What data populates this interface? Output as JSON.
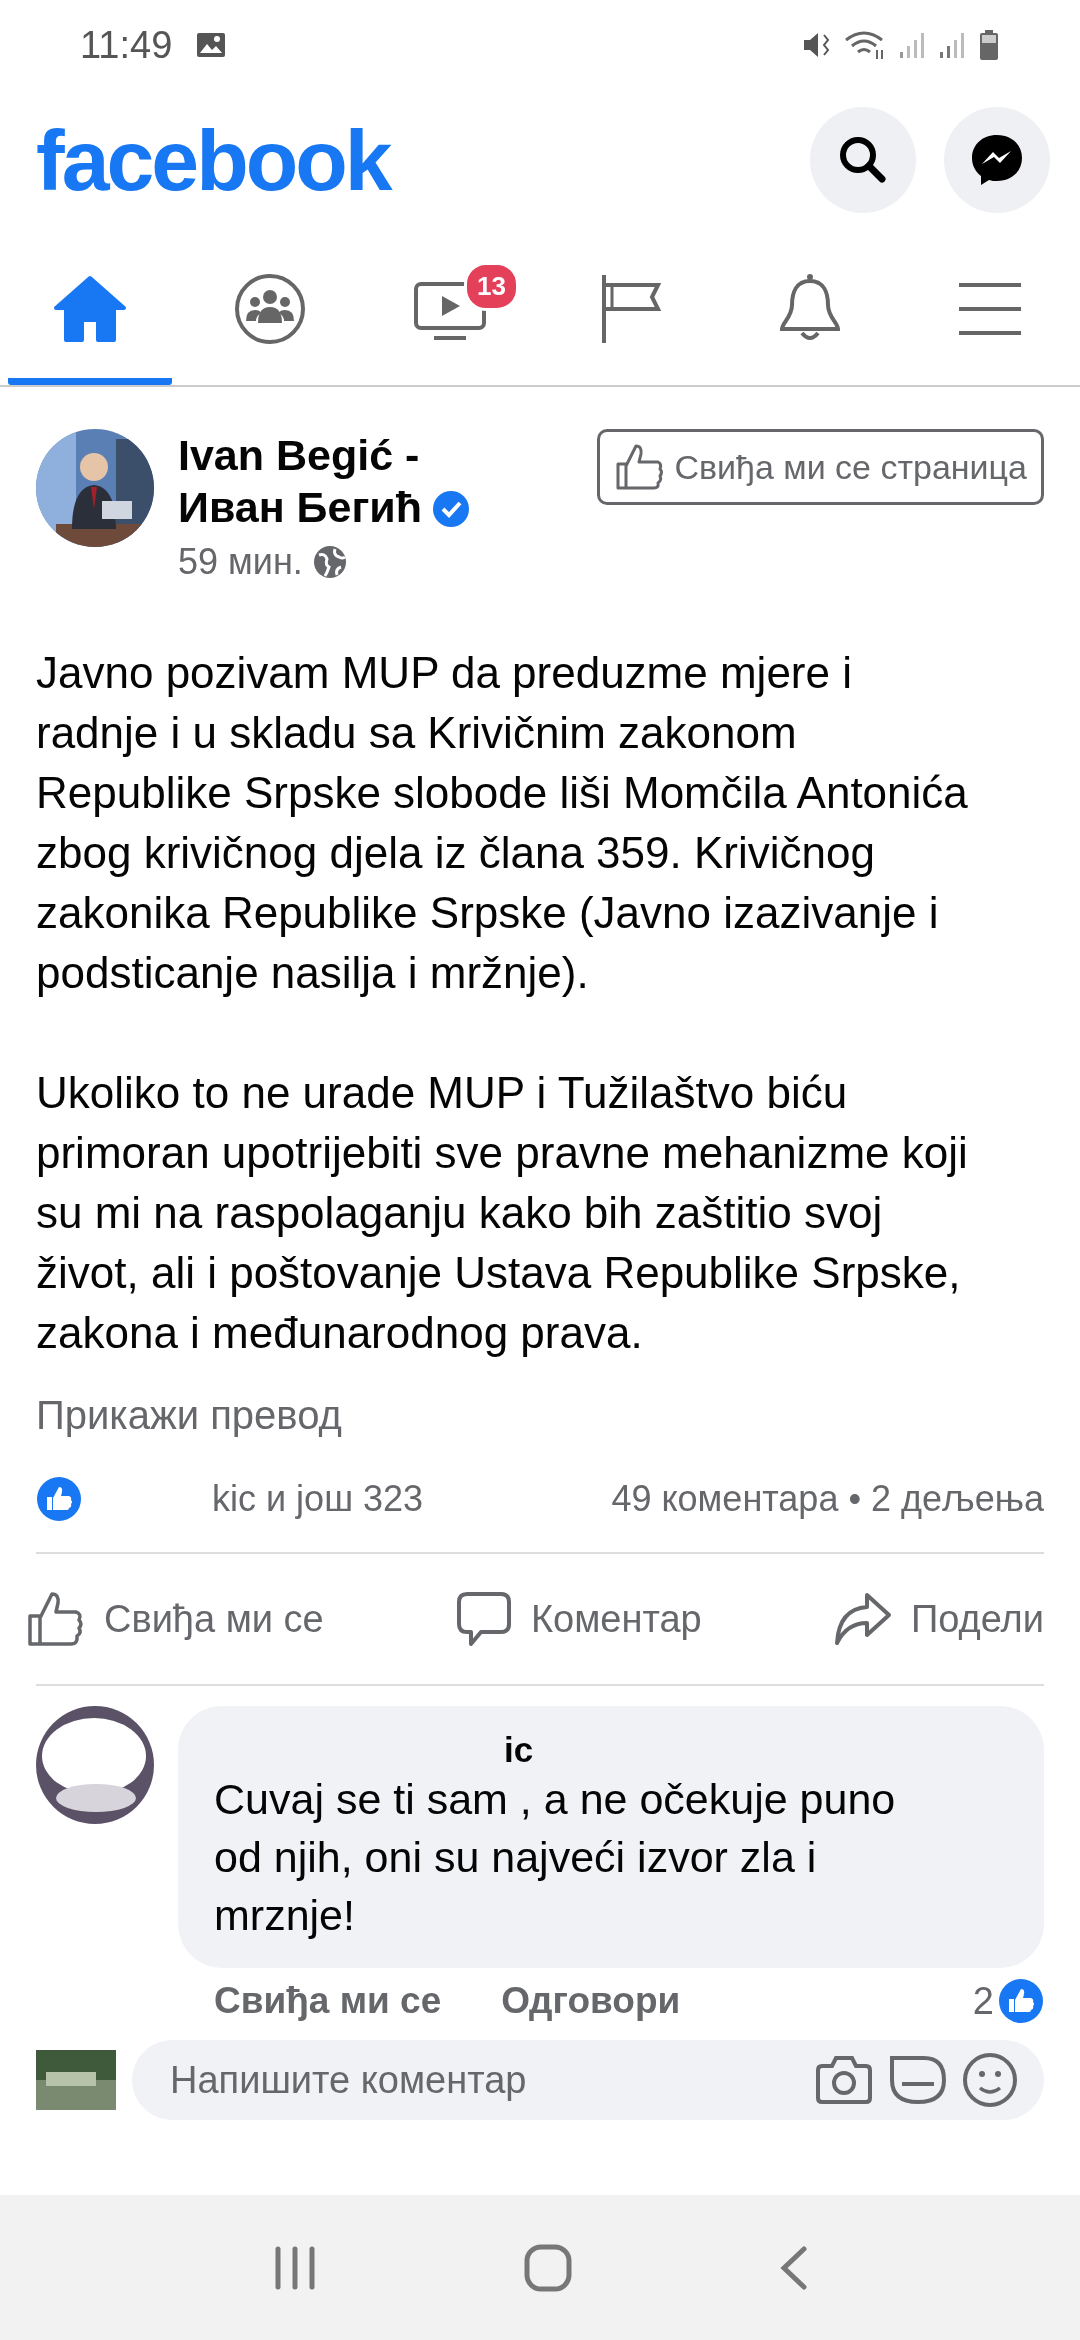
{
  "status_bar": {
    "time": "11:49"
  },
  "header": {
    "logo": "facebook"
  },
  "tabs": [
    {
      "kind": "home",
      "selected": true
    },
    {
      "kind": "groups",
      "selected": false
    },
    {
      "kind": "watch",
      "selected": false,
      "badge": "13"
    },
    {
      "kind": "pages",
      "selected": false
    },
    {
      "kind": "notifications",
      "selected": false
    },
    {
      "kind": "menu",
      "selected": false
    }
  ],
  "post": {
    "author": "Ivan Begić - Иван Бегић",
    "verified": true,
    "time": "59 мин.",
    "like_page": "Свиђа ми се страница",
    "paragraphs": [
      "Javno pozivam MUP da preduzme mjere i radnje i u skladu sa Krivičnim zakonom Republike Srpske slobode liši Momčila Antonića zbog krivičnog djela iz člana 359. Krivičnog zakonika Republike Srpske (Javno izazivanje i podsticanje nasilja i mržnje).",
      "Ukoliko to ne urade MUP i Tužilaštvo biću primoran upotrijebiti sve pravne mehanizme koji su mi na raspolaganju kako bih zaštitio svoj život, ali i poštovanje Ustava Republike Srpske, zakona i međunarodnog prava."
    ],
    "translate": "Прикажи превод",
    "reactions": "kic и још 323",
    "comments_count": "49 коментара • 2 дељења",
    "actions": [
      {
        "kind": "like",
        "label": "Свиђа ми се"
      },
      {
        "kind": "comment",
        "label": "Коментар"
      },
      {
        "kind": "share",
        "label": "Подели"
      }
    ]
  },
  "comment": {
    "author": "ic",
    "text": "Cuvaj se ti sam , a ne očekuje puno od njih, oni su najveći izvor zla i mrznje!",
    "like": "Свиђа ми се",
    "reply": "Одговори",
    "reaction_count": "2"
  },
  "composer": {
    "placeholder": "Напишите коментар"
  }
}
